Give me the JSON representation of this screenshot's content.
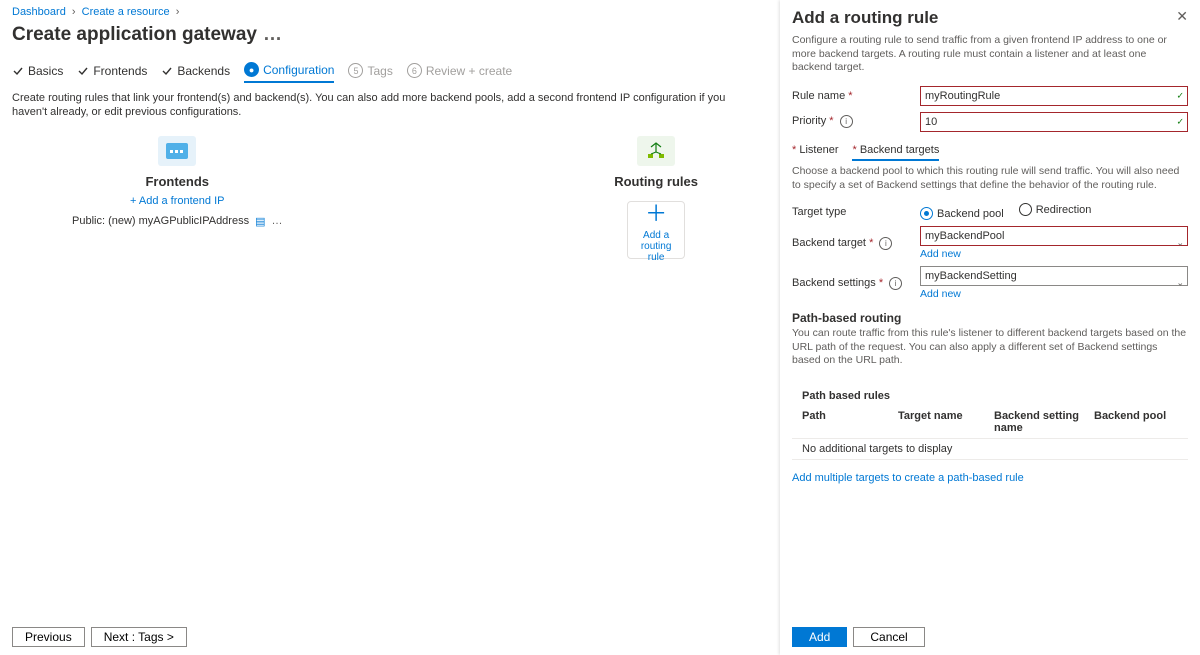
{
  "crumbs": {
    "a": "Dashboard",
    "b": "Create a resource"
  },
  "pageTitle": "Create application gateway",
  "steps": {
    "basics": "Basics",
    "frontends": "Frontends",
    "backends": "Backends",
    "config": "Configuration",
    "tagsNum": "5",
    "tags": "Tags",
    "reviewNum": "6",
    "review": "Review + create"
  },
  "hint": "Create routing rules that link your frontend(s) and backend(s). You can also add more backend pools, add a second frontend IP configuration if you haven't already, or edit previous configurations.",
  "frontends": {
    "title": "Frontends",
    "addLink": "+ Add a frontend IP",
    "ip": "Public: (new) myAGPublicIPAddress"
  },
  "rules": {
    "title": "Routing rules",
    "tileLabel": "Add a routing rule"
  },
  "footer": {
    "prev": "Previous",
    "next": "Next : Tags >"
  },
  "panel": {
    "title": "Add a routing rule",
    "desc": "Configure a routing rule to send traffic from a given frontend IP address to one or more backend targets. A routing rule must contain a listener and at least one backend target.",
    "ruleNameLabel": "Rule name",
    "ruleName": "myRoutingRule",
    "priorityLabel": "Priority",
    "priority": "10",
    "tabListener": "Listener",
    "tabTargets": "Backend targets",
    "targetsDesc": "Choose a backend pool to which this routing rule will send traffic. You will also need to specify a set of Backend settings that define the behavior of the routing rule.",
    "targetTypeLabel": "Target type",
    "tt1": "Backend pool",
    "tt2": "Redirection",
    "backendTargetLabel": "Backend target",
    "backendTarget": "myBackendPool",
    "addNew": "Add new",
    "backendSettingsLabel": "Backend settings",
    "backendSettings": "myBackendSetting",
    "pathSection": "Path-based routing",
    "pathDesc": "You can route traffic from this rule's listener to different backend targets based on the URL path of the request. You can also apply a different set of Backend settings based on the URL path.",
    "tblTitle": "Path based rules",
    "th1": "Path",
    "th2": "Target name",
    "th3": "Backend setting name",
    "th4": "Backend pool",
    "emptyRow": "No additional targets to display",
    "addMulti": "Add multiple targets to create a path-based rule",
    "add": "Add",
    "cancel": "Cancel"
  }
}
